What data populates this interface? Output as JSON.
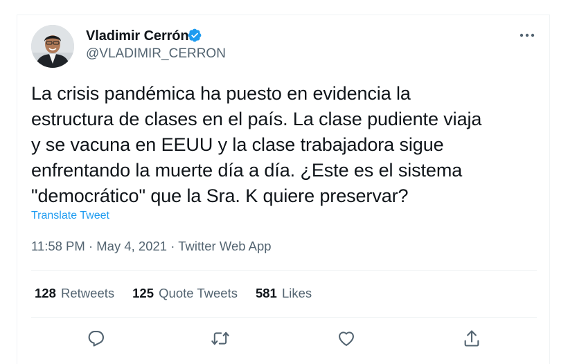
{
  "author": {
    "name": "Vladimir Cerrón",
    "handle": "@VLADIMIR_CERRON",
    "verified": true,
    "avatar_icon": "user-avatar-photo"
  },
  "tweet": {
    "text": "La crisis pandémica ha puesto en evidencia la\nestructura de clases en el país. La clase pudiente viaja\ny se vacuna en EEUU y la clase trabajadora sigue\nenfrentando la muerte día a día. ¿Este es el sistema\n\"democrático\" que la Sra. K quiere preservar?",
    "translate_label": "Translate Tweet",
    "time": "11:58 PM",
    "separator": " · ",
    "date": "May 4, 2021",
    "source": "Twitter Web App"
  },
  "stats": {
    "retweets_count": "128",
    "retweets_label": "Retweets",
    "quotes_count": "125",
    "quotes_label": "Quote Tweets",
    "likes_count": "581",
    "likes_label": "Likes"
  },
  "actions": [
    "reply-icon",
    "retweet-icon",
    "like-icon",
    "share-icon"
  ],
  "colors": {
    "accent": "#1d9bf0",
    "secondary_text": "#536471",
    "primary_text": "#0f1419",
    "divider": "#eff3f4"
  }
}
